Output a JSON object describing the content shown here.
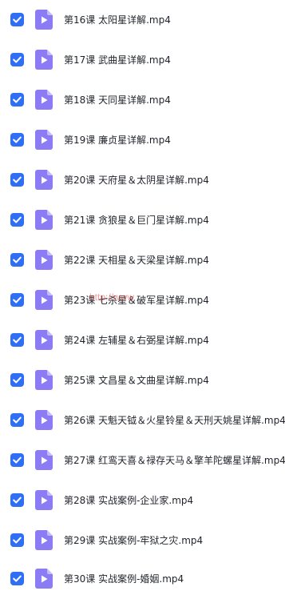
{
  "files": [
    {
      "name": "第16课 太阳星详解.mp4",
      "checked": true
    },
    {
      "name": "第17课 武曲星详解.mp4",
      "checked": true
    },
    {
      "name": "第18课 天同星详解.mp4",
      "checked": true
    },
    {
      "name": "第19课 廉贞星详解.mp4",
      "checked": true
    },
    {
      "name": "第20课 天府星＆太阴星详解.mp4",
      "checked": true
    },
    {
      "name": "第21课 贪狼星＆巨门星详解.mp4",
      "checked": true
    },
    {
      "name": "第22课 天相星＆天梁星详解.mp4",
      "checked": true
    },
    {
      "name": "第23课 七杀星＆破军星详解.mp4",
      "checked": true
    },
    {
      "name": "第24课 左辅星＆右弼星详解.mp4",
      "checked": true
    },
    {
      "name": "第25课 文昌星＆文曲星详解.mp4",
      "checked": true
    },
    {
      "name": "第26课 天魁天钺＆火星铃星＆天刑天姚星详解.mp4",
      "checked": true
    },
    {
      "name": "第27课 红鸾天喜＆禄存天马＆擎羊陀螺星详解.mp4",
      "checked": true
    },
    {
      "name": "第28课 实战案例-企业家.mp4",
      "checked": true
    },
    {
      "name": "第29课 实战案例-牢狱之灾.mp4",
      "checked": true
    },
    {
      "name": "第30课 实战案例-婚姻.mp4",
      "checked": true
    }
  ],
  "icons": {
    "checkbox": "checkbox-checked-icon",
    "file": "video-file-icon"
  },
  "colors": {
    "checkbox": "#2f6ff5",
    "file_icon": "#8b7cf6",
    "file_icon_fold": "#c4bafc",
    "text": "#1f2329"
  },
  "watermark": "http://www"
}
